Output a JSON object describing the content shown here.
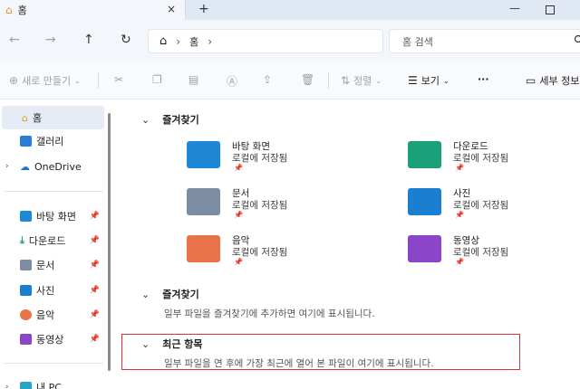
{
  "window": {
    "tab_title": "홈",
    "close_tab": "×",
    "new_tab": "+",
    "minimize": "—"
  },
  "nav": {
    "back": "←",
    "forward": "→",
    "up": "↑",
    "refresh": "↻"
  },
  "address": {
    "home_glyph": "⌂",
    "crumb": "홈",
    "sep": "›"
  },
  "search": {
    "placeholder": "홈 검색"
  },
  "toolbar": {
    "new_label": "새로 만들기",
    "sort_label": "정렬",
    "view_label": "보기",
    "more_label": "···",
    "details_label": "세부 정보"
  },
  "sidebar": {
    "items": [
      {
        "label": "홈"
      },
      {
        "label": "갤러리"
      },
      {
        "label": "OneDrive"
      },
      {
        "label": "바탕 화면"
      },
      {
        "label": "다운로드"
      },
      {
        "label": "문서"
      },
      {
        "label": "사진"
      },
      {
        "label": "음악"
      },
      {
        "label": "동영상"
      },
      {
        "label": "내 PC"
      }
    ]
  },
  "main": {
    "favorites_head": "즐겨찾기",
    "folders": [
      {
        "name": "바탕 화면",
        "sub": "로컬에 저장됨",
        "color": "#1e88d6"
      },
      {
        "name": "다운로드",
        "sub": "로컬에 저장됨",
        "color": "#1aa17a"
      },
      {
        "name": "문서",
        "sub": "로컬에 저장됨",
        "color": "#7c8ca3"
      },
      {
        "name": "사진",
        "sub": "로컬에 저장됨",
        "color": "#1b7fd1"
      },
      {
        "name": "음악",
        "sub": "로컬에 저장됨",
        "color": "#e9744a"
      },
      {
        "name": "동영상",
        "sub": "로컬에 저장됨",
        "color": "#8a45c9"
      }
    ],
    "favorites2_head": "즐겨찾기",
    "favorites2_note": "일부 파일을 즐겨찾기에 추가하면 여기에 표시됩니다.",
    "recent_head": "최근 항목",
    "recent_note": "일부 파일을 연 후에 가장 최근에 열어 본 파일이 여기에 표시됩니다."
  },
  "colors": {
    "accent": "#0067c0",
    "highlight": "#d9323a"
  }
}
